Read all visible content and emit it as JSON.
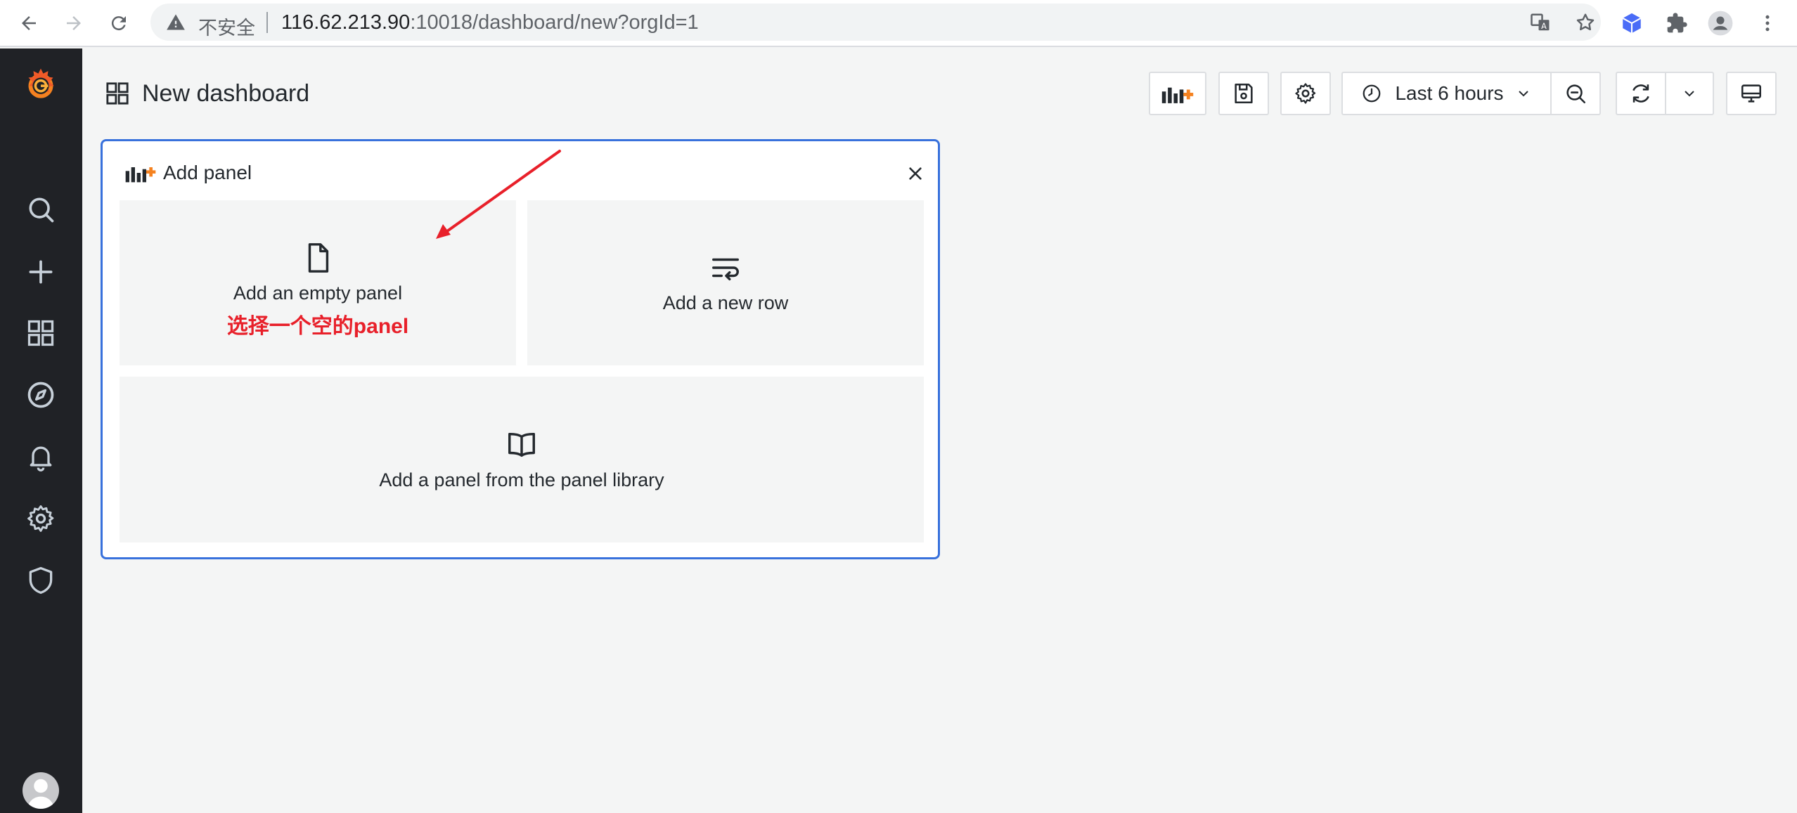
{
  "browser": {
    "insecure_label": "不安全",
    "url_host": "116.62.213.90",
    "url_rest": ":10018/dashboard/new?orgId=1"
  },
  "dashboard": {
    "title": "New dashboard",
    "time_range": "Last 6 hours"
  },
  "add_panel": {
    "title": "Add panel",
    "options": {
      "empty": "Add an empty panel",
      "row": "Add a new row",
      "library": "Add a panel from the panel library"
    },
    "annotation": "选择一个空的panel"
  },
  "colors": {
    "accent": "#3871dc",
    "sidebar": "#202226",
    "annotation": "#e8202a",
    "grafana_orange": "#f58220"
  }
}
